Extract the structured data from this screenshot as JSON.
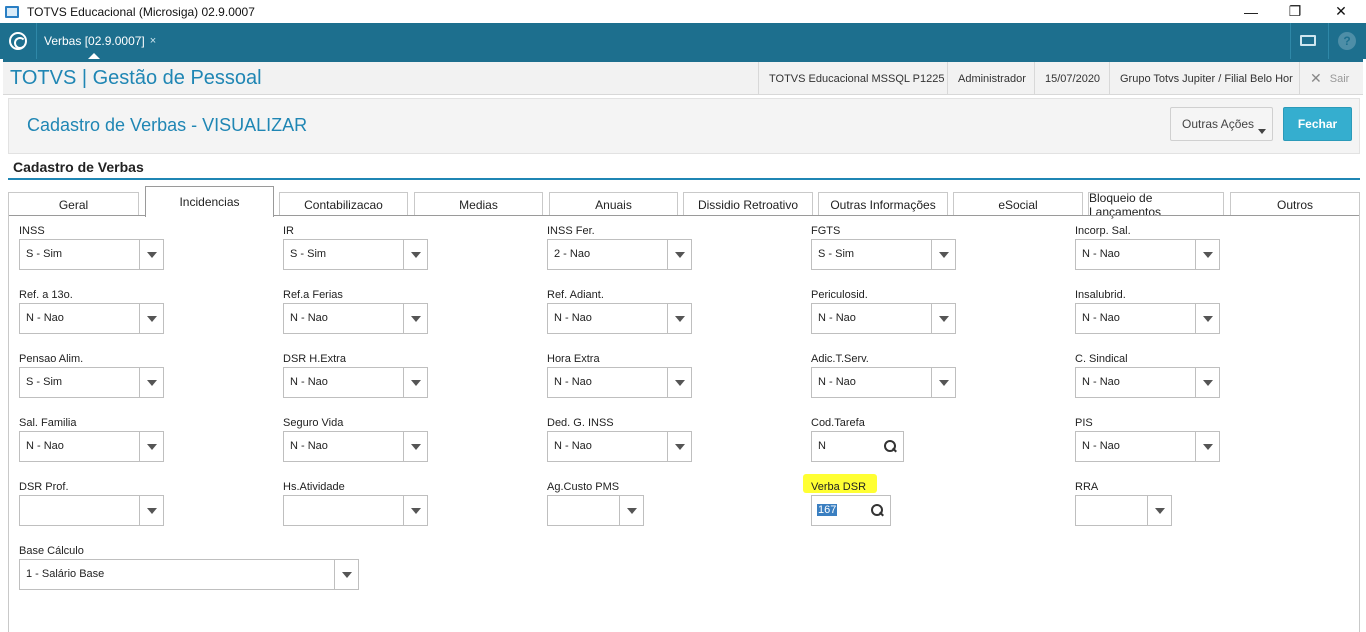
{
  "window": {
    "title": "TOTVS Educacional (Microsiga) 02.9.0007",
    "minimize": "—",
    "restore": "❐",
    "close": "✕"
  },
  "tabbar": {
    "doc_tab": "Verbas [02.9.0007]",
    "doc_tab_close": "×",
    "help": "?"
  },
  "header": {
    "app_title": "TOTVS | Gestão de Pessoal",
    "environment": "TOTVS Educacional MSSQL P1225",
    "user": "Administrador",
    "date": "15/07/2020",
    "branch": "Grupo Totvs Jupiter / Filial Belo Hor",
    "exit": "Sair",
    "exit_icon": "✕"
  },
  "page": {
    "title": "Cadastro de Verbas - VISUALIZAR",
    "other_actions": "Outras Ações",
    "close": "Fechar",
    "section": "Cadastro de Verbas"
  },
  "tabs": [
    "Geral",
    "Incidencias",
    "Contabilizacao",
    "Medias",
    "Anuais",
    "Dissidio Retroativo",
    "Outras Informações",
    "eSocial",
    "Bloqueio de Lançamentos",
    "Outros"
  ],
  "active_tab": "Incidencias",
  "fields": {
    "inss": {
      "label": "INSS",
      "value": "S - Sim"
    },
    "ir": {
      "label": "IR",
      "value": "S - Sim"
    },
    "inss_fer": {
      "label": "INSS Fer.",
      "value": "2 - Nao"
    },
    "fgts": {
      "label": "FGTS",
      "value": "S - Sim"
    },
    "incorp_sal": {
      "label": "Incorp. Sal.",
      "value": "N - Nao"
    },
    "ref_13": {
      "label": "Ref. a 13o.",
      "value": "N - Nao"
    },
    "ref_ferias": {
      "label": "Ref.a Ferias",
      "value": "N - Nao"
    },
    "ref_adiant": {
      "label": "Ref. Adiant.",
      "value": "N - Nao"
    },
    "periculosid": {
      "label": "Periculosid.",
      "value": "N - Nao"
    },
    "insalubrid": {
      "label": "Insalubrid.",
      "value": "N - Nao"
    },
    "pensao_alim": {
      "label": "Pensao Alim.",
      "value": "S - Sim"
    },
    "dsr_hextra": {
      "label": "DSR H.Extra",
      "value": "N - Nao"
    },
    "hora_extra": {
      "label": "Hora Extra",
      "value": "N - Nao"
    },
    "adic_tserv": {
      "label": "Adic.T.Serv.",
      "value": "N - Nao"
    },
    "c_sindical": {
      "label": "C. Sindical",
      "value": "N - Nao"
    },
    "sal_familia": {
      "label": "Sal. Familia",
      "value": "N - Nao"
    },
    "seguro_vida": {
      "label": "Seguro Vida",
      "value": "N - Nao"
    },
    "ded_g_inss": {
      "label": "Ded. G. INSS",
      "value": "N - Nao"
    },
    "cod_tarefa": {
      "label": "Cod.Tarefa",
      "value": "N"
    },
    "pis": {
      "label": "PIS",
      "value": "N - Nao"
    },
    "dsr_prof": {
      "label": "DSR Prof.",
      "value": ""
    },
    "hs_atividade": {
      "label": "Hs.Atividade",
      "value": ""
    },
    "ag_custo_pms": {
      "label": "Ag.Custo PMS",
      "value": ""
    },
    "verba_dsr": {
      "label": "Verba DSR",
      "value": "167"
    },
    "rra": {
      "label": "RRA",
      "value": ""
    },
    "base_calculo": {
      "label": "Base Cálculo",
      "value": "1 - Salário Base"
    }
  },
  "colors": {
    "brand_bar": "#1d6f8e",
    "title_blue": "#1f86b4",
    "primary_button": "#35aecf",
    "highlight": "#ffff33",
    "selection": "#3a7fc1"
  }
}
